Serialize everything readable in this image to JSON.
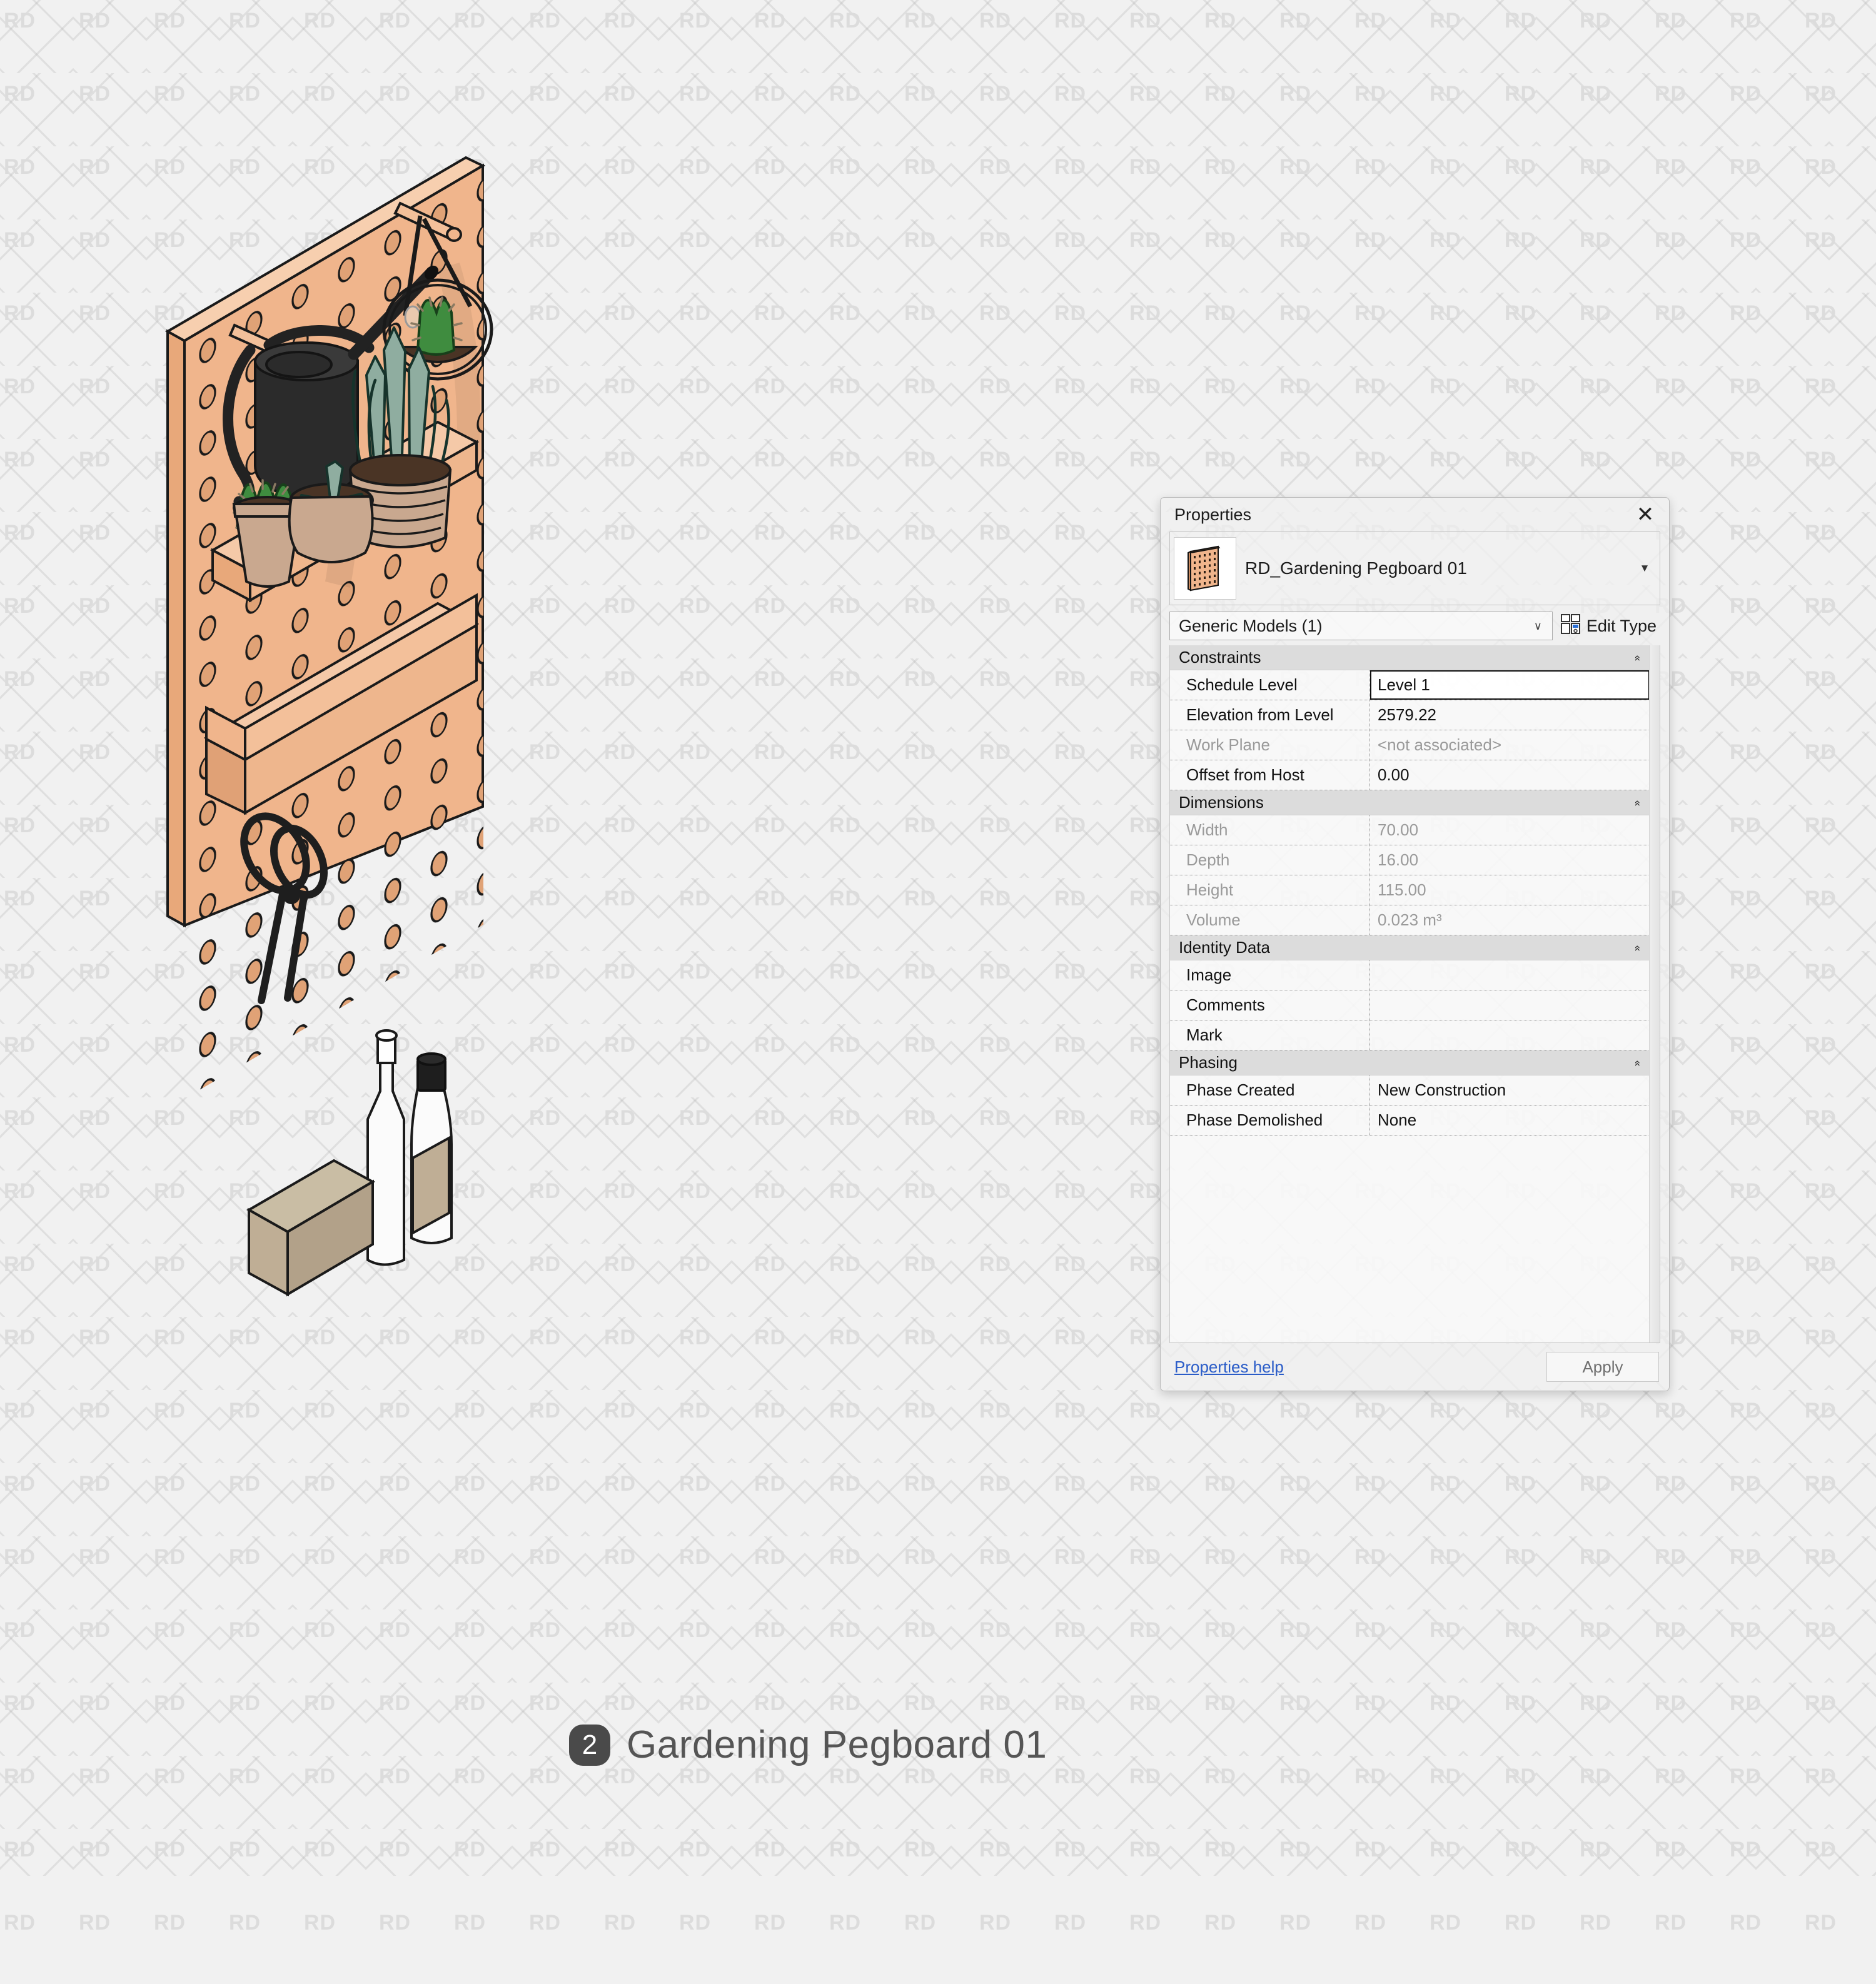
{
  "caption": {
    "badge": "2",
    "title": "Gardening Pegboard 01"
  },
  "watermark": {
    "text": "RD"
  },
  "properties_panel": {
    "title": "Properties",
    "close_icon": "✕",
    "type_selector": {
      "name": "RD_Gardening Pegboard 01",
      "caret_icon": "▼",
      "thumbnail_icon": "pegboard-thumbnail"
    },
    "category": {
      "value": "Generic Models (1)",
      "caret_icon": "∨"
    },
    "edit_type_label": "Edit Type",
    "groups": [
      {
        "label": "Constraints",
        "collapse_icon": "«",
        "rows": [
          {
            "key": "Schedule Level",
            "value": "Level 1",
            "dim": false,
            "selected": true
          },
          {
            "key": "Elevation from Level",
            "value": "2579.22",
            "dim": false,
            "selected": false
          },
          {
            "key": "Work Plane",
            "value": "<not associated>",
            "dim": true,
            "selected": false
          },
          {
            "key": "Offset from Host",
            "value": "0.00",
            "dim": false,
            "selected": false
          }
        ]
      },
      {
        "label": "Dimensions",
        "collapse_icon": "«",
        "rows": [
          {
            "key": "Width",
            "value": "70.00",
            "dim": true,
            "selected": false
          },
          {
            "key": "Depth",
            "value": "16.00",
            "dim": true,
            "selected": false
          },
          {
            "key": "Height",
            "value": "115.00",
            "dim": true,
            "selected": false
          },
          {
            "key": "Volume",
            "value": "0.023 m³",
            "dim": true,
            "selected": false
          }
        ]
      },
      {
        "label": "Identity Data",
        "collapse_icon": "«",
        "rows": [
          {
            "key": "Image",
            "value": "",
            "dim": false,
            "selected": false
          },
          {
            "key": "Comments",
            "value": "",
            "dim": false,
            "selected": false
          },
          {
            "key": "Mark",
            "value": "",
            "dim": false,
            "selected": false
          }
        ]
      },
      {
        "label": "Phasing",
        "collapse_icon": "«",
        "rows": [
          {
            "key": "Phase Created",
            "value": "New Construction",
            "dim": false,
            "selected": false
          },
          {
            "key": "Phase Demolished",
            "value": "None",
            "dim": false,
            "selected": false
          }
        ]
      }
    ],
    "footer": {
      "help_link": "Properties help",
      "apply_label": "Apply"
    }
  },
  "illustration": {
    "name": "gardening-pegboard-isometric",
    "colors": {
      "board_face": "#f0b58c",
      "board_edge": "#e8a87a",
      "board_top": "#f5c9a8",
      "outline": "#1a1a1a",
      "metal_black": "#2b2b2b",
      "pot_terracotta": "#c9a88f",
      "pot_soil": "#4a3425",
      "leaf_green": "#3f8c3f",
      "leaf_sage": "#8fada0",
      "bottle_white": "#fbfbfb",
      "box_tan": "#bfae95"
    },
    "items": [
      "pegboard-panel",
      "watering-can",
      "hanging-planter-cactus",
      "snake-plant-pot",
      "cactus-pot",
      "succulent-pot",
      "scissors",
      "glass-bottle",
      "spray-bottle",
      "wooden-box",
      "upper-shelf",
      "lower-tray-shelf"
    ]
  }
}
